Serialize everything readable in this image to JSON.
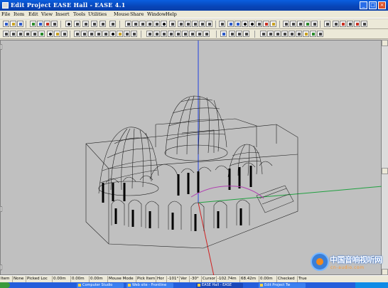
{
  "window": {
    "title": "Edit Project EASE Hall - EASE 4.1"
  },
  "menu": [
    "File",
    "Item",
    "Edit",
    "View",
    "Insert",
    "Tools",
    "Utilities",
    "Mouse",
    "Share",
    "Window",
    "Help"
  ],
  "statusbar": {
    "cells": [
      "Item",
      "None",
      "Picked Loc",
      "0.00m",
      "0.00m",
      "0.00m",
      "Mouse Mode",
      "Pick Item",
      "Hor",
      "-101°",
      "Ver",
      "-30°",
      "Cursor",
      "-102.74m",
      "68.42m",
      "0.00m",
      "Checked",
      "True"
    ]
  },
  "taskbar": {
    "items": [
      "Computer Studio",
      "Web site - Frontline",
      "EASE Hall - EASE",
      "Edit Project Tw"
    ]
  },
  "watermark": {
    "text": "中国音响视听网",
    "sub": "cn-audio.com"
  },
  "colors": {
    "titlebar": "#0845b8",
    "viewport": "#c0c0c0",
    "axis_x": "#d02020",
    "axis_y": "#20a040",
    "axis_z": "#2040e0"
  }
}
